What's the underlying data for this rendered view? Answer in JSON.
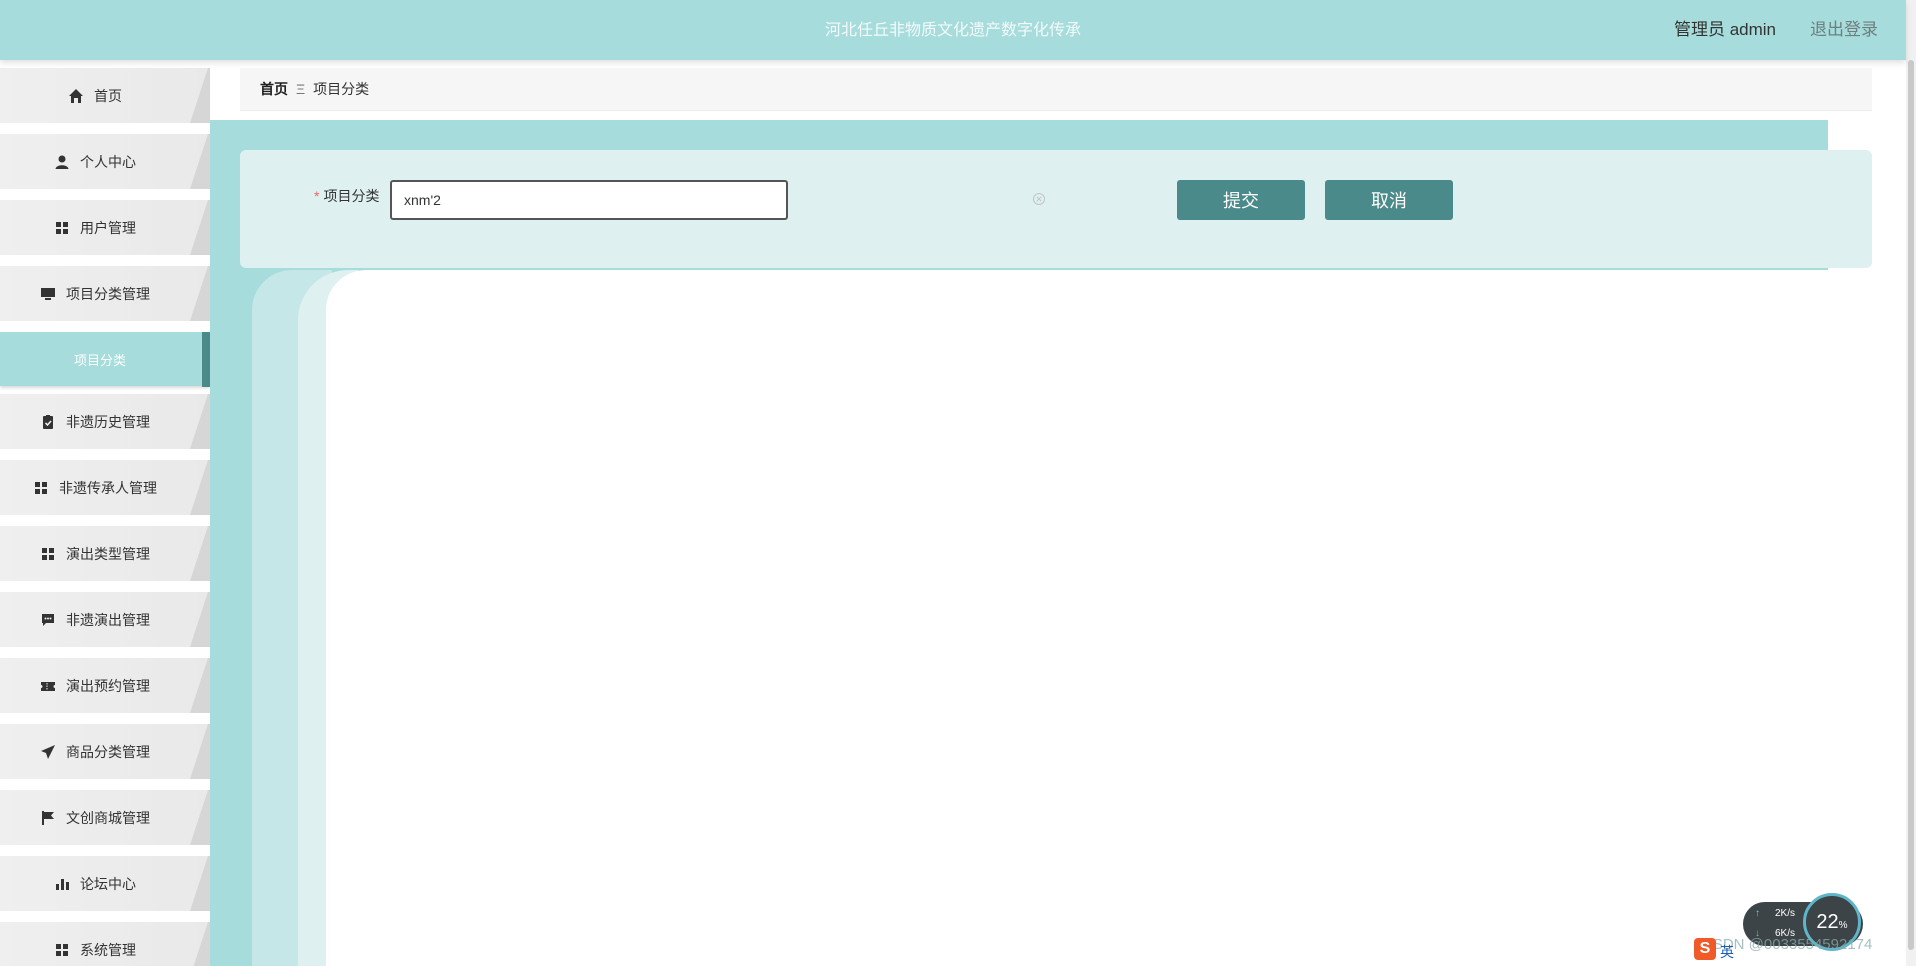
{
  "header": {
    "title": "河北任丘非物质文化遗产数字化传承",
    "user_label": "管理员 admin",
    "logout_label": "退出登录"
  },
  "sidebar": {
    "items": [
      {
        "label": "首页",
        "icon": "home-icon"
      },
      {
        "label": "个人中心",
        "icon": "user-icon"
      },
      {
        "label": "用户管理",
        "icon": "grid-icon"
      },
      {
        "label": "项目分类管理",
        "icon": "monitor-icon"
      },
      {
        "label": "项目分类",
        "icon": "",
        "active": true
      },
      {
        "label": "非遗历史管理",
        "icon": "clipboard-icon"
      },
      {
        "label": "非遗传承人管理",
        "icon": "grid-icon"
      },
      {
        "label": "演出类型管理",
        "icon": "grid-icon"
      },
      {
        "label": "非遗演出管理",
        "icon": "comment-icon"
      },
      {
        "label": "演出预约管理",
        "icon": "ticket-icon"
      },
      {
        "label": "商品分类管理",
        "icon": "send-icon"
      },
      {
        "label": "文创商城管理",
        "icon": "flag-icon"
      },
      {
        "label": "论坛中心",
        "icon": "bar-chart-icon"
      },
      {
        "label": "系统管理",
        "icon": "grid-icon"
      }
    ]
  },
  "breadcrumb": {
    "home": "首页",
    "separator": "Ξ",
    "current": "项目分类"
  },
  "form": {
    "required_mark": "*",
    "field_label": "项目分类",
    "field_value": "xnm'2",
    "submit_label": "提交",
    "cancel_label": "取消"
  },
  "tray": {
    "upload_speed": "2K/s",
    "download_speed": "6K/s",
    "cpu_percent": "22",
    "cpu_unit": "%",
    "ime_label": "英",
    "watermark": "CSDN @0033554592174"
  },
  "colors": {
    "accent": "#a6dcdc",
    "button": "#4b8a8a",
    "panel": "#dff0f0"
  }
}
